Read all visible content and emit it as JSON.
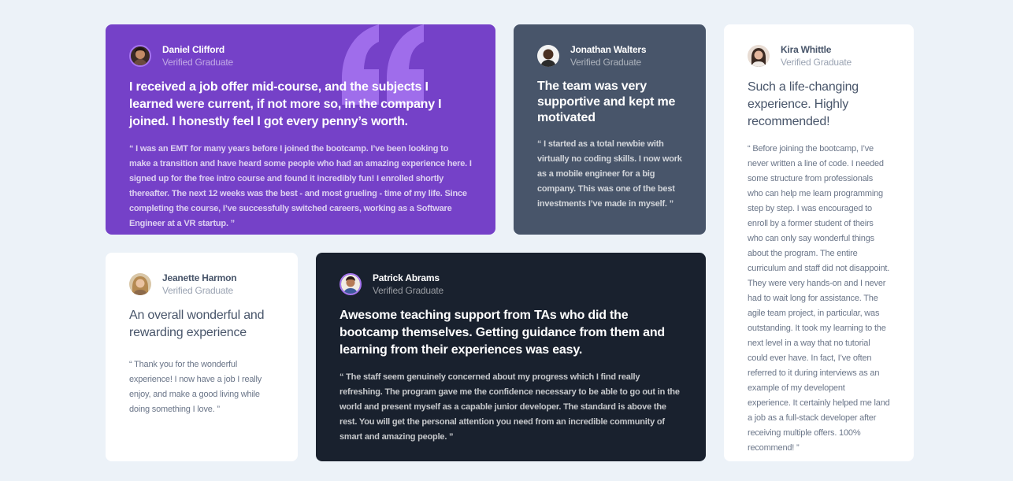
{
  "testimonials": [
    {
      "name": "Daniel Clifford",
      "role": "Verified Graduate",
      "headline": "I received a job offer mid-course, and the subjects I learned were current, if not more so, in the company I joined. I honestly feel I got every penny’s worth.",
      "body": "“ I was an EMT for many years before I joined the bootcamp. I’ve been looking to make a transition and have heard some people who had an amazing experience here. I signed up for the free intro course and found it incredibly fun! I enrolled shortly thereafter. The next 12 weeks was the best - and most grueling - time of my life. Since completing the course, I’ve successfully switched careers, working as a Software Engineer at a VR startup. ”"
    },
    {
      "name": "Jonathan Walters",
      "role": "Verified Graduate",
      "headline": "The team was very supportive and kept me motivated",
      "body": "“ I started as a total newbie with virtually no coding skills. I now work as a mobile engineer for a big company. This was one of the best investments I’ve made in myself. ”"
    },
    {
      "name": "Kira Whittle",
      "role": "Verified Graduate",
      "headline": "Such a life-changing experience. Highly recommended!",
      "body": "“ Before joining the bootcamp, I’ve never written a line of code. I needed some structure from professionals who can help me learn programming step by step. I was encouraged to enroll by a former student of theirs who can only say wonderful things about the program. The entire curriculum and staff did not disappoint. They were very hands-on and I never had to wait long for assistance. The agile team project, in particular, was outstanding. It took my learning to the next level in a way that no tutorial could ever have. In fact, I’ve often referred to it during interviews as an example of my developent experience. It certainly helped me land a job as a full-stack developer after receiving multiple offers. 100% recommend! ”"
    },
    {
      "name": "Jeanette Harmon",
      "role": "Verified Graduate",
      "headline": "An overall wonderful and rewarding experience",
      "body": "“ Thank you for the wonderful experience! I now have a job I really enjoy, and make a good living while doing something I love. ”"
    },
    {
      "name": "Patrick Abrams",
      "role": "Verified Graduate",
      "headline": "Awesome teaching support from TAs who did the bootcamp themselves. Getting guidance from them and learning from their experiences was easy.",
      "body": "“ The staff seem genuinely concerned about my progress which I find really refreshing. The program gave me the confidence necessary to be able to go out in the world and present myself as a capable junior developer. The standard is above the rest. You will get the personal attention you need from an incredible community of smart and amazing people. ”"
    }
  ],
  "colors": {
    "page_bg": "#ecf2f8",
    "purple": "#7541c8",
    "grayish_blue": "#48556a",
    "dark_blue": "#19212e",
    "white": "#ffffff",
    "quote_mark": "#a775f1"
  },
  "icons": {
    "card_1_decoration": "quotation-mark-icon"
  }
}
